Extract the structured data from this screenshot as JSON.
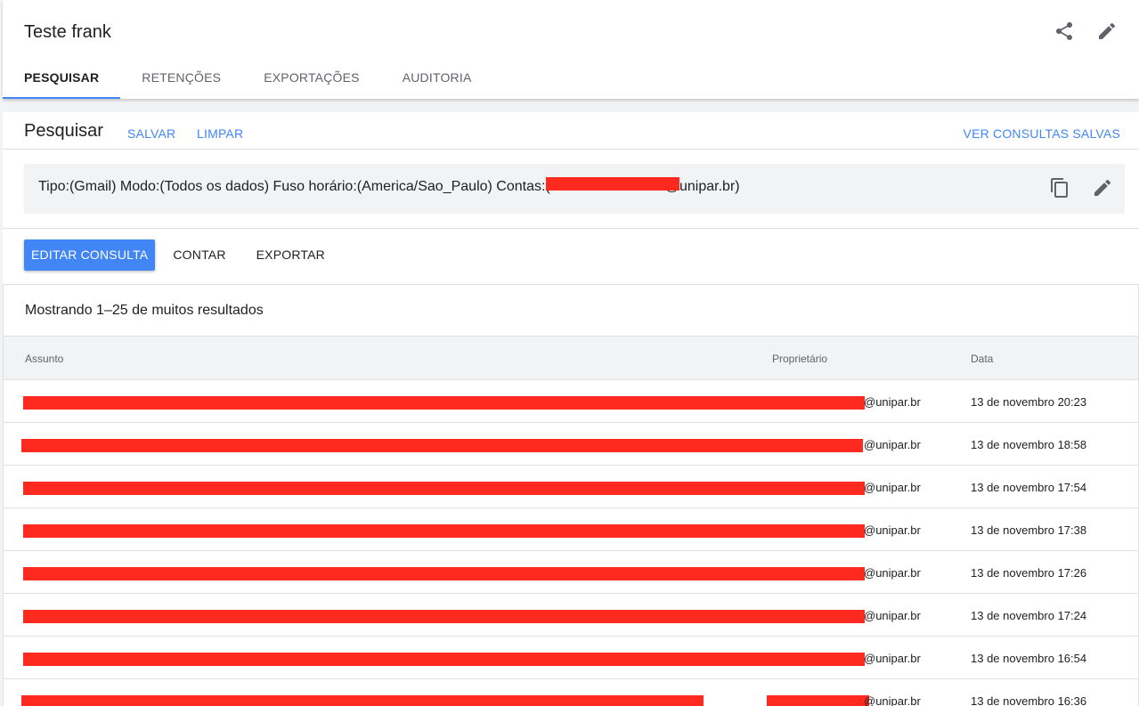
{
  "header": {
    "title": "Teste frank",
    "tabs": [
      {
        "label": "PESQUISAR",
        "active": true
      },
      {
        "label": "RETENÇÕES",
        "active": false
      },
      {
        "label": "EXPORTAÇÕES",
        "active": false
      },
      {
        "label": "AUDITORIA",
        "active": false
      }
    ],
    "icons": [
      "share-icon",
      "edit-icon"
    ]
  },
  "search": {
    "title": "Pesquisar",
    "save_label": "SALVAR",
    "clear_label": "LIMPAR",
    "saved_queries_label": "VER CONSULTAS SALVAS",
    "query_prefix": "Tipo:(Gmail) Modo:(Todos os dados) Fuso horário:(America/Sao_Paulo) Contas:(",
    "query_suffix": "@unipar.br)",
    "query_icons": [
      "copy-icon",
      "edit-icon"
    ]
  },
  "actions": {
    "edit_query_label": "EDITAR CONSULTA",
    "count_label": "CONTAR",
    "export_label": "EXPORTAR"
  },
  "results": {
    "summary": "Mostrando 1–25 de muitos resultados",
    "columns": [
      "Assunto",
      "Proprietário",
      "Data"
    ],
    "rows": [
      {
        "owner": "@unipar.br",
        "date": "13 de novembro 20:23"
      },
      {
        "owner": "@unipar.br",
        "date": "13 de novembro 18:58"
      },
      {
        "owner": "@unipar.br",
        "date": "13 de novembro 17:54"
      },
      {
        "owner": "@unipar.br",
        "date": "13 de novembro 17:38"
      },
      {
        "owner": "@unipar.br",
        "date": "13 de novembro 17:26"
      },
      {
        "owner": "@unipar.br",
        "date": "13 de novembro 17:24"
      },
      {
        "owner": "@unipar.br",
        "date": "13 de novembro 16:54"
      },
      {
        "owner": "@unipar.br",
        "date": "13 de novembro 16:36"
      }
    ]
  },
  "colors": {
    "accent": "#4285f4",
    "redaction": "#ff2a1f",
    "text": "#202124",
    "muted": "#5f6368"
  }
}
